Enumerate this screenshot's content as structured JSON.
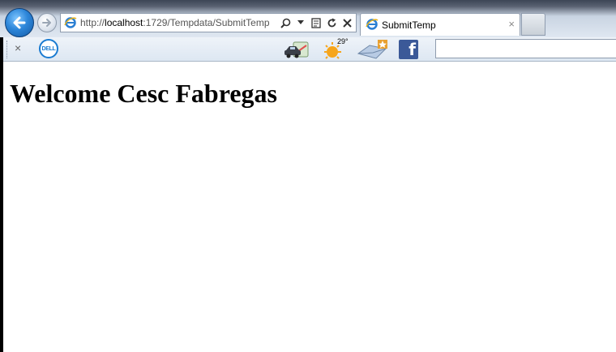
{
  "browser": {
    "address_url_prefix": "http://",
    "address_host": "localhost",
    "address_path": ":1729/Tempdata/SubmitTemp",
    "tab_title": "SubmitTemp",
    "tab_close": "×",
    "toolbar_close": "×",
    "weather_temp": "29°",
    "dell_label": "DELL",
    "facebook_label": "f",
    "search_value": ""
  },
  "page": {
    "heading": "Welcome Cesc Fabregas"
  },
  "icons": {
    "back": "back-arrow-icon",
    "forward": "forward-arrow-icon",
    "search": "search-icon",
    "dropdown": "chevron-down-icon",
    "compat": "compatibility-view-icon",
    "refresh": "refresh-icon",
    "stop": "stop-icon"
  },
  "colors": {
    "back_button": "#2d86d9",
    "facebook": "#3b5998",
    "dell": "#1a7bd1"
  }
}
